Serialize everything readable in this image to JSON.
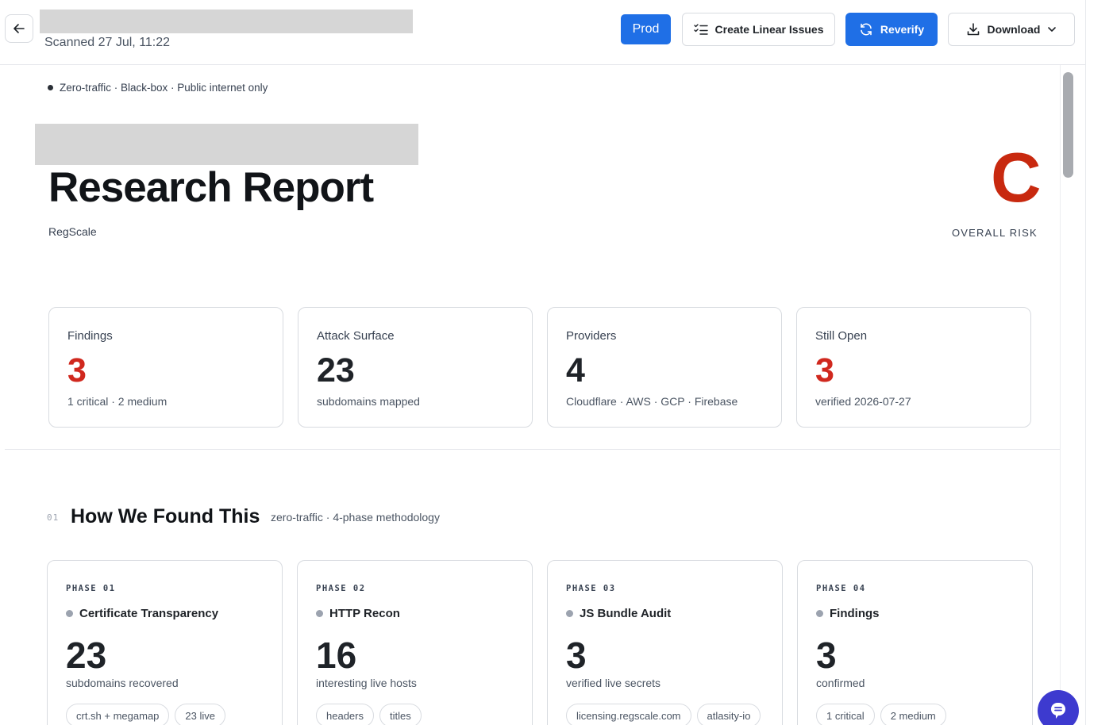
{
  "header": {
    "scanned": "Scanned 27 Jul, 11:22",
    "prod_label": "Prod",
    "linear_label": "Create Linear Issues",
    "reverify_label": "Reverify",
    "download_label": "Download"
  },
  "report": {
    "badge_text": "Zero-traffic · Black-box · Public internet only",
    "title": "Research Report",
    "company": "RegScale",
    "risk_grade": "C",
    "risk_label": "OVERALL RISK"
  },
  "stats": [
    {
      "label": "Findings",
      "value": "3",
      "sub": "1 critical · 2 medium",
      "color": "#d0281e"
    },
    {
      "label": "Attack Surface",
      "value": "23",
      "sub": "subdomains mapped",
      "color": "#1f2328"
    },
    {
      "label": "Providers",
      "value": "4",
      "sub": "Cloudflare · AWS · GCP · Firebase",
      "color": "#1f2328"
    },
    {
      "label": "Still Open",
      "value": "3",
      "sub": "verified 2026-07-27",
      "color": "#d0281e"
    }
  ],
  "section": {
    "number": "01",
    "title": "How We Found This",
    "subtitle": "zero-traffic · 4-phase methodology"
  },
  "phases": [
    {
      "tag": "PHASE 01",
      "name": "Certificate Transparency",
      "value": "23",
      "sub": "subdomains recovered",
      "chips": [
        "crt.sh + megamap",
        "23 live"
      ]
    },
    {
      "tag": "PHASE 02",
      "name": "HTTP Recon",
      "value": "16",
      "sub": "interesting live hosts",
      "chips": [
        "headers",
        "titles"
      ]
    },
    {
      "tag": "PHASE 03",
      "name": "JS Bundle Audit",
      "value": "3",
      "sub": "verified live secrets",
      "chips": [
        "licensing.regscale.com",
        "atlasity-io"
      ]
    },
    {
      "tag": "PHASE 04",
      "name": "Findings",
      "value": "3",
      "sub": "confirmed",
      "chips": [
        "1 critical",
        "2 medium"
      ]
    }
  ],
  "colors": {
    "accent": "#1f6fe6",
    "risk": "#c8290f",
    "danger": "#d0281e",
    "chat": "#3d3acf"
  }
}
